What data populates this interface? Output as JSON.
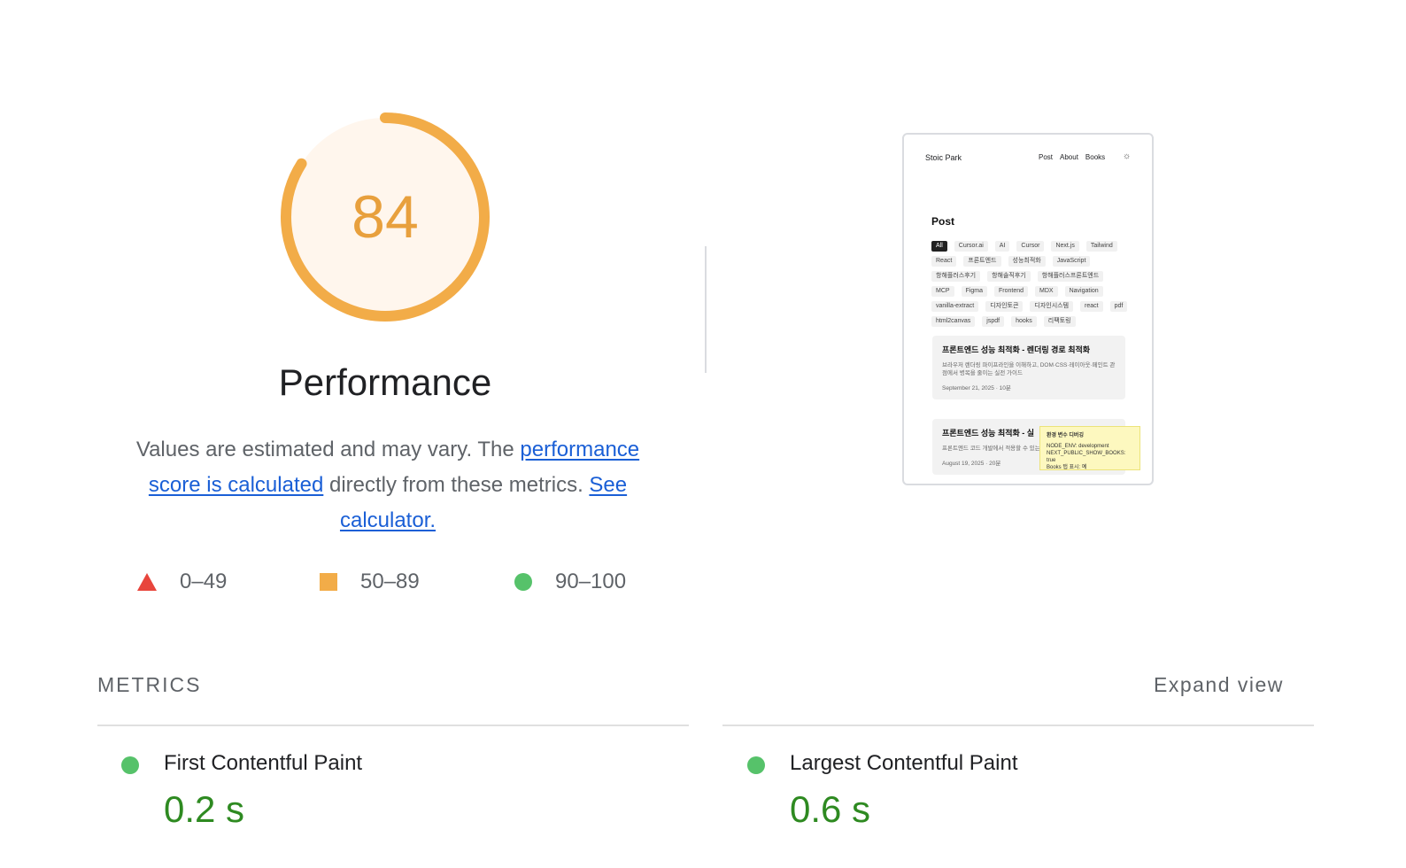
{
  "score": {
    "value": "84",
    "fraction": 0.84,
    "color": "#f2ac48",
    "background": "#fff6ed",
    "title": "Performance"
  },
  "description": {
    "text_before": "Values are estimated and may vary. The ",
    "link_calc": "performance score is calculated",
    "text_middle": " directly from these metrics. ",
    "link_calculator": "See calculator."
  },
  "legend": [
    {
      "icon": "triangle-icon",
      "color": "#e8453c",
      "label": "0–49"
    },
    {
      "icon": "square-icon",
      "color": "#f2ac48",
      "label": "50–89"
    },
    {
      "icon": "circle-icon",
      "color": "#56c26a",
      "label": "90–100"
    }
  ],
  "thumbnail": {
    "site_name": "Stoic Park",
    "nav": [
      "Post",
      "About",
      "Books"
    ],
    "theme_icon": "sun-icon",
    "heading": "Post",
    "tags": [
      "All",
      "Cursor.ai",
      "AI",
      "Cursor",
      "Next.js",
      "Tailwind",
      "React",
      "프론트엔드",
      "성능최적화",
      "JavaScript",
      "항해플러스후기",
      "항해솔직후기",
      "항해플러스프론트엔드",
      "MCP",
      "Figma",
      "Frontend",
      "MDX",
      "Navigation",
      "vanilla-extract",
      "디자인토큰",
      "디자인시스템",
      "react",
      "pdf",
      "html2canvas",
      "jspdf",
      "hooks",
      "리팩토링"
    ],
    "cards": [
      {
        "title": "프론트엔드 성능 최적화 - 렌더링 경로 최적화",
        "desc": "브라우저 렌더링 파이프라인을 이해하고, DOM·CSS·레이아웃·페인트 관점에서 병목을 줄이는 실전 가이드",
        "meta": "September 21, 2025 · 10분"
      },
      {
        "title": "프론트엔드 성능 최적화 - 실",
        "desc": "프론트엔드 코드 개발에서 적용할 수 있는 정리한 가이드",
        "meta": "August 19, 2025 · 20분"
      }
    ],
    "env_box": {
      "title": "환경 변수 디버깅",
      "lines": [
        "NODE_ENV: development",
        "NEXT_PUBLIC_SHOW_BOOKS: true",
        "Books 탭 표시: 예"
      ]
    }
  },
  "metrics": {
    "title": "METRICS",
    "expand_label": "Expand view",
    "items": [
      {
        "label": "First Contentful Paint",
        "value": "0.2 s",
        "status_color": "#56c26a"
      },
      {
        "label": "Largest Contentful Paint",
        "value": "0.6 s",
        "status_color": "#56c26a"
      }
    ]
  }
}
